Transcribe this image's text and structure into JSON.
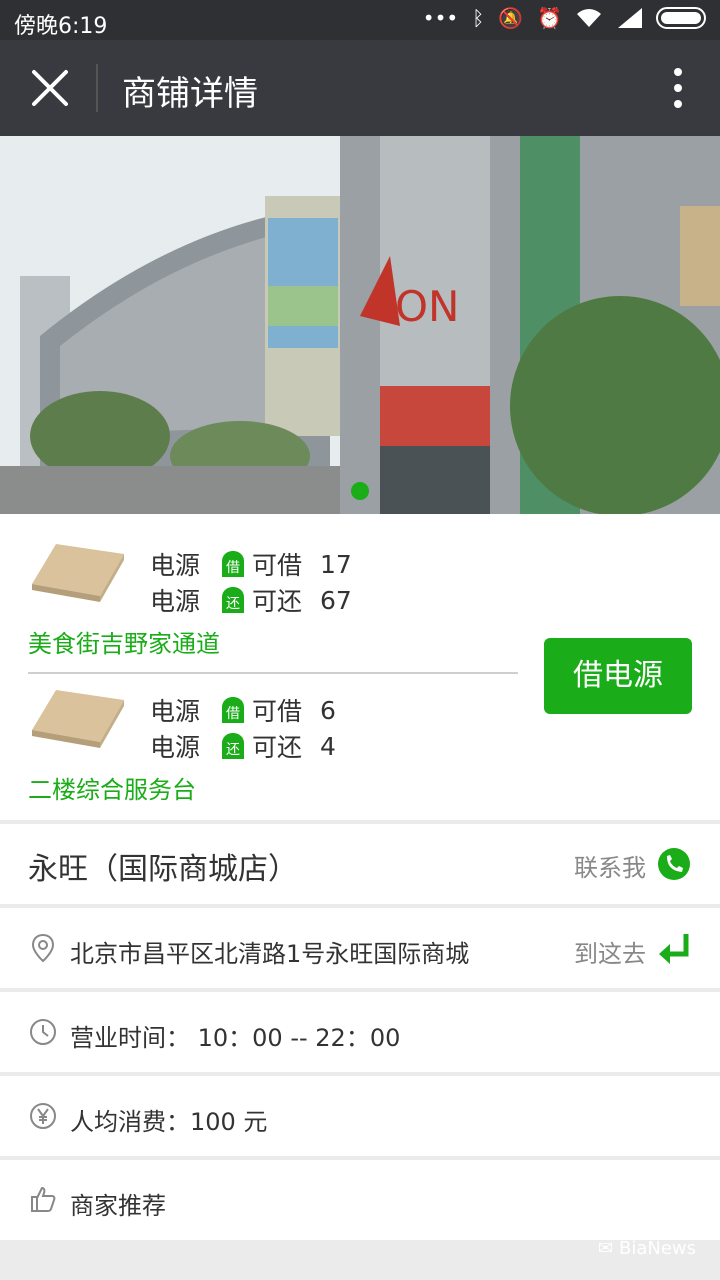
{
  "status_bar": {
    "time": "傍晚6:19",
    "icons": [
      "more-dots-icon",
      "bluetooth-icon",
      "mute-icon",
      "alarm-icon",
      "wifi-icon",
      "signal-icon",
      "battery-icon"
    ]
  },
  "header": {
    "title": "商铺详情"
  },
  "colors": {
    "accent": "#1aad19",
    "topbar": "#393a3f",
    "statusbar": "#2f3033"
  },
  "carousel": {
    "active_index": 0
  },
  "stations": [
    {
      "borrow_label": "电源",
      "borrow_badge": "借",
      "borrow_text": "可借",
      "borrow_count": "17",
      "return_label": "电源",
      "return_badge": "还",
      "return_text": "可还",
      "return_count": "67",
      "location": "美食街吉野家通道"
    },
    {
      "borrow_label": "电源",
      "borrow_badge": "借",
      "borrow_text": "可借",
      "borrow_count": "6",
      "return_label": "电源",
      "return_badge": "还",
      "return_text": "可还",
      "return_count": "4",
      "location": "二楼综合服务台"
    }
  ],
  "borrow_button": "借电源",
  "store": {
    "name": "永旺（国际商城店）",
    "contact": "联系我"
  },
  "address": {
    "text": "北京市昌平区北清路1号永旺国际商城",
    "navigate": "到这去"
  },
  "hours": {
    "text": "营业时间：  10：00  --  22：00"
  },
  "avg_spend": {
    "text": "人均消费：100 元"
  },
  "recommend": {
    "text": "商家推荐"
  },
  "watermark": "BiaNews"
}
